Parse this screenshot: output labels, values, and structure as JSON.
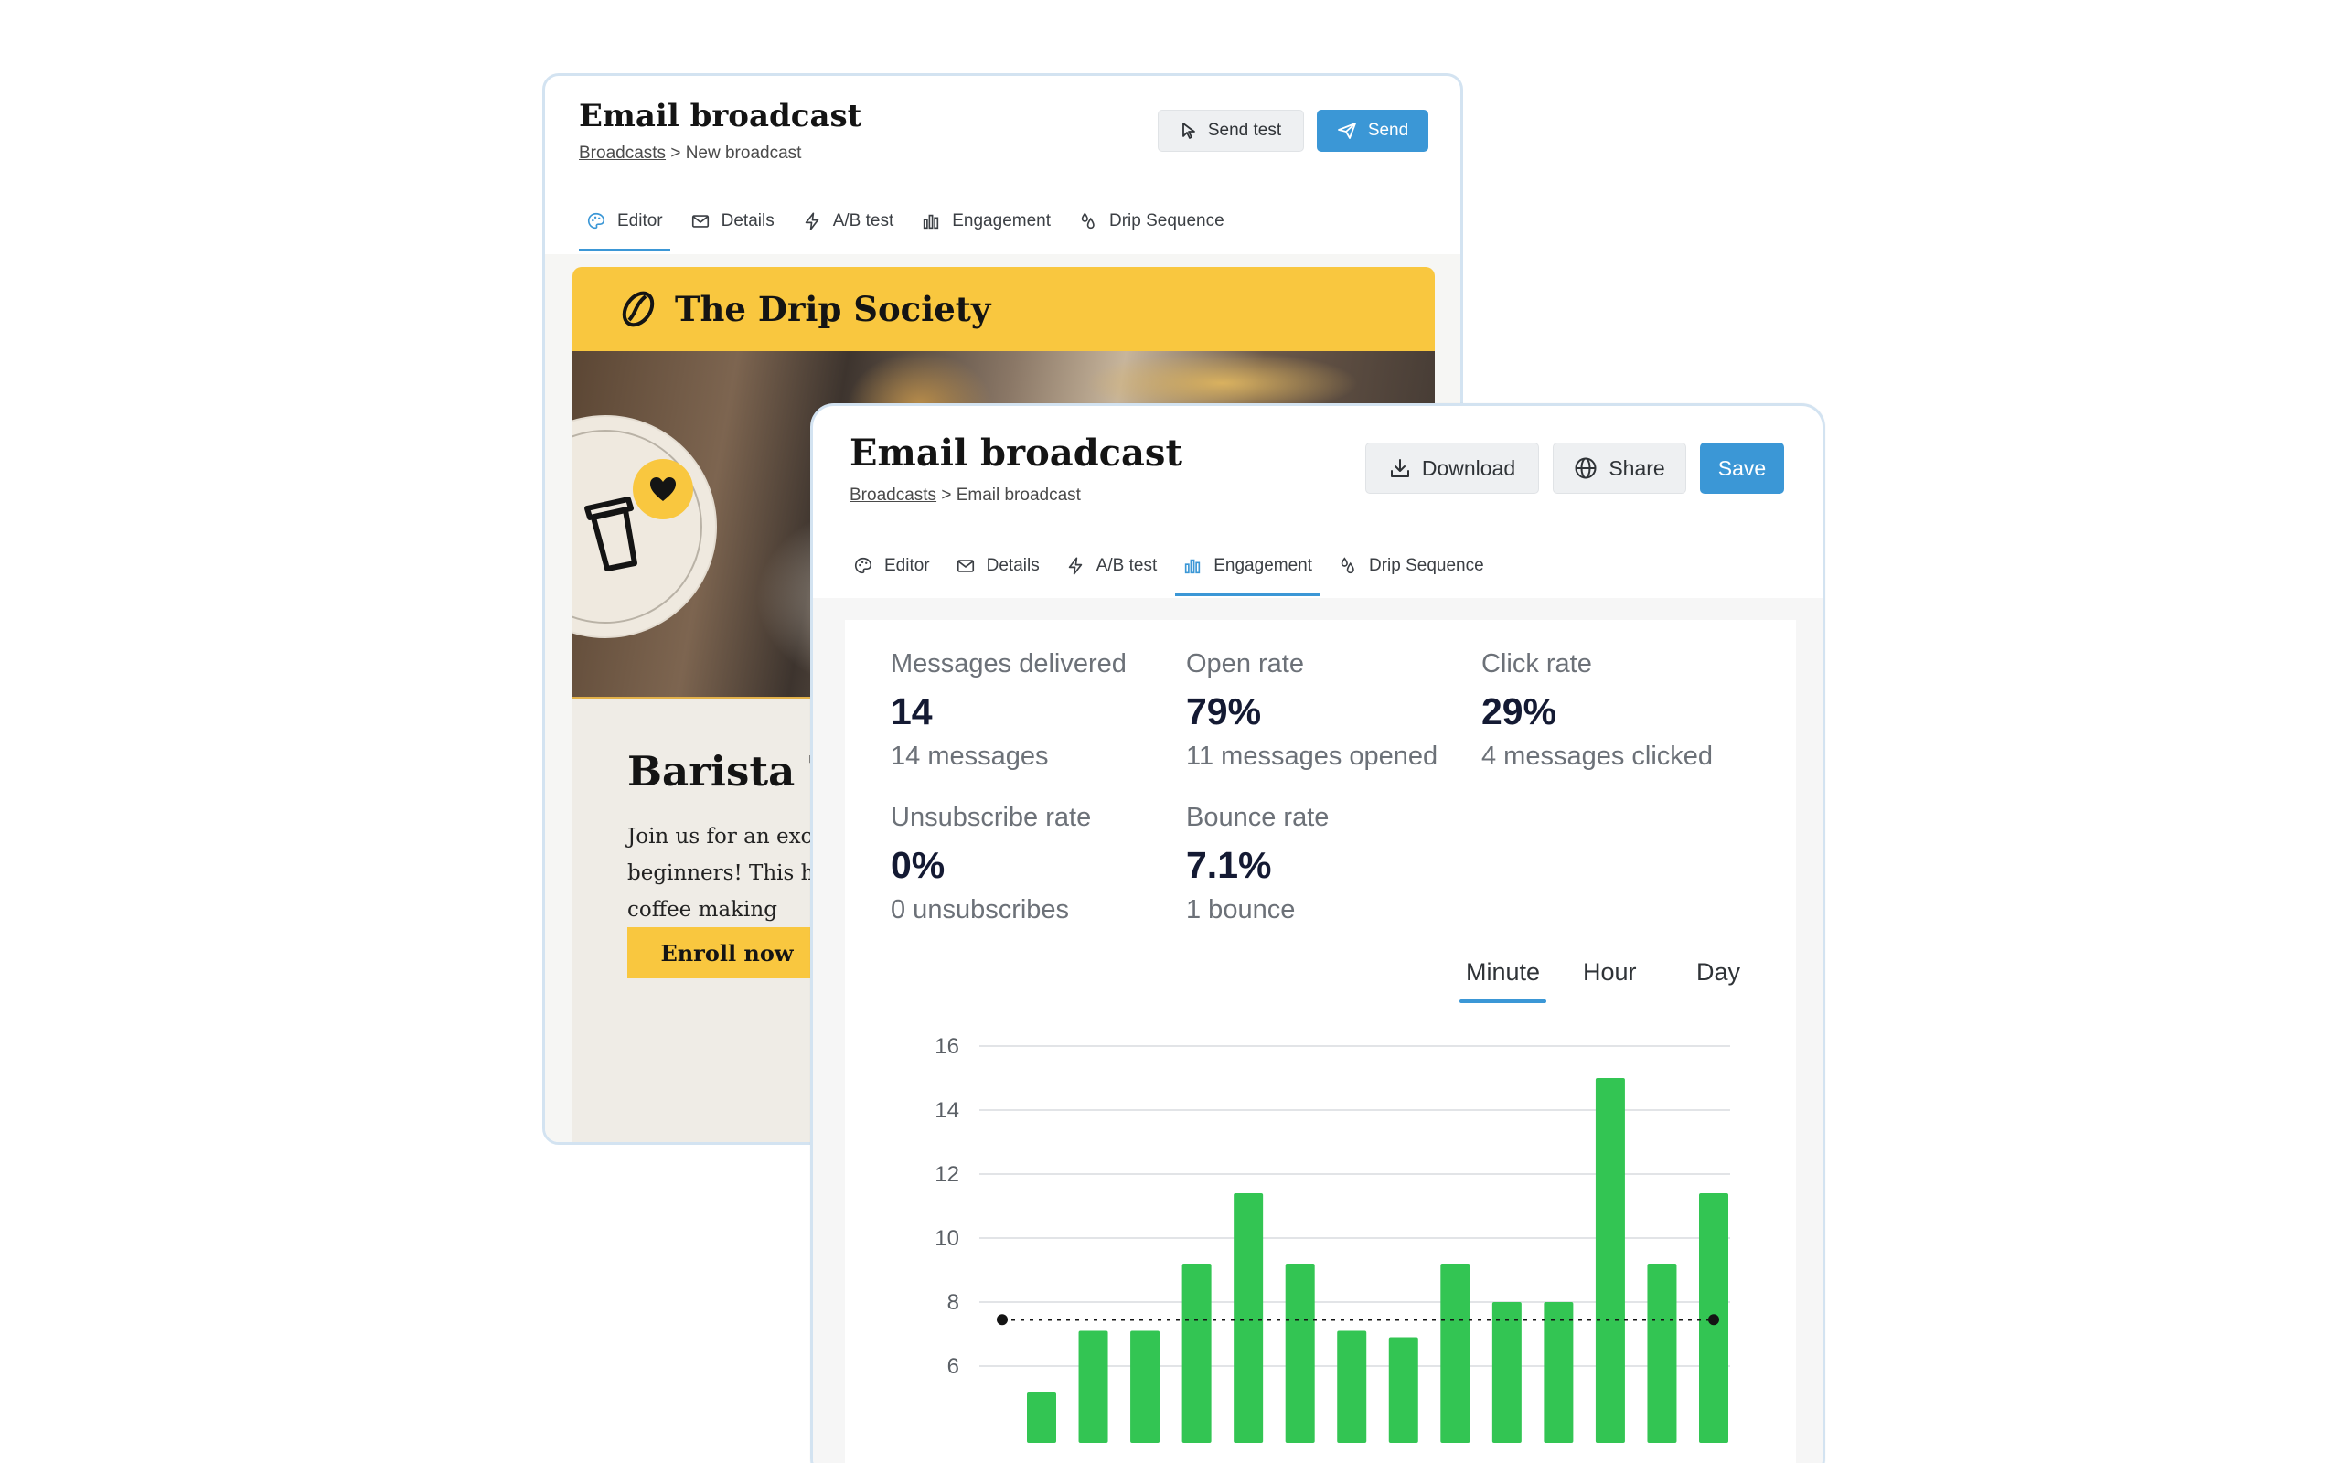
{
  "back_window": {
    "title": "Email broadcast",
    "breadcrumb_link": "Broadcasts",
    "breadcrumb_rest": " > New broadcast",
    "send_test_label": "Send test",
    "send_label": "Send",
    "tabs": [
      {
        "label": "Editor",
        "icon": "palette-icon",
        "active": true
      },
      {
        "label": "Details",
        "icon": "envelope-icon",
        "active": false
      },
      {
        "label": "A/B test",
        "icon": "lightning-icon",
        "active": false
      },
      {
        "label": "Engagement",
        "icon": "bar-chart-icon",
        "active": false
      },
      {
        "label": "Drip Sequence",
        "icon": "drops-icon",
        "active": false
      }
    ],
    "email": {
      "brand": "The Drip Society",
      "headline": "Barista T",
      "body_lines": [
        "Join us for an exci",
        "beginners! This ha",
        "coffee making"
      ],
      "cta": "Enroll now"
    }
  },
  "front_window": {
    "title": "Email broadcast",
    "breadcrumb_link": "Broadcasts",
    "breadcrumb_rest": " > Email broadcast",
    "download_label": "Download",
    "share_label": "Share",
    "save_label": "Save",
    "tabs": [
      {
        "label": "Editor",
        "icon": "palette-icon",
        "active": false
      },
      {
        "label": "Details",
        "icon": "envelope-icon",
        "active": false
      },
      {
        "label": "A/B test",
        "icon": "lightning-icon",
        "active": false
      },
      {
        "label": "Engagement",
        "icon": "bar-chart-icon",
        "active": true
      },
      {
        "label": "Drip Sequence",
        "icon": "drops-icon",
        "active": false
      }
    ],
    "stats": [
      {
        "label": "Messages delivered",
        "value": "14",
        "sub": "14 messages"
      },
      {
        "label": "Open rate",
        "value": "79%",
        "sub": "11 messages opened"
      },
      {
        "label": "Click rate",
        "value": "29%",
        "sub": "4 messages clicked"
      },
      {
        "label": "Unsubscribe rate",
        "value": "0%",
        "sub": "0 unsubscribes"
      },
      {
        "label": "Bounce rate",
        "value": "7.1%",
        "sub": "1 bounce"
      }
    ],
    "range_tabs": [
      {
        "label": "Minute",
        "active": true
      },
      {
        "label": "Hour",
        "active": false
      },
      {
        "label": "Day",
        "active": false
      }
    ]
  },
  "colors": {
    "accent_blue": "#3b97d6",
    "brand_yellow": "#f9c73f",
    "bar_green": "#33c553"
  },
  "chart_data": {
    "type": "bar",
    "y_ticks": [
      6,
      8,
      10,
      12,
      14,
      16
    ],
    "values": [
      5.2,
      7.1,
      7.1,
      9.2,
      11.4,
      9.2,
      7.1,
      6.9,
      9.2,
      8.0,
      8.0,
      15.0,
      9.2,
      11.4
    ],
    "average_line": 7.45,
    "grid": true
  }
}
